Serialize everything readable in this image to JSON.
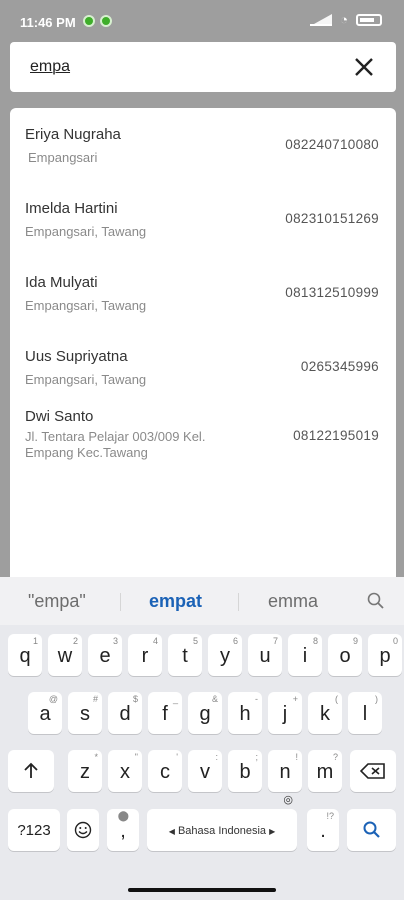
{
  "status_bar": {
    "time": "11:46 PM"
  },
  "search": {
    "query": "empa",
    "close_icon": "close-icon"
  },
  "results": [
    {
      "name": "Eriya Nugraha",
      "address": "Empangsari",
      "phone": "082240710080"
    },
    {
      "name": "Imelda Hartini",
      "address": "Empangsari, Tawang",
      "phone": "082310151269"
    },
    {
      "name": "Ida Mulyati",
      "address": "Empangsari, Tawang",
      "phone": "081312510999"
    },
    {
      "name": "Uus Supriyatna",
      "address": "Empangsari, Tawang",
      "phone": "0265345996"
    },
    {
      "name": "Dwi Santo",
      "address_line1": "Jl. Tentara Pelajar 003/009 Kel.",
      "address_line2": "Empang Kec.Tawang",
      "phone": "08122195019"
    }
  ],
  "keyboard": {
    "suggestions": [
      "\"empa\"",
      "empat",
      "emma"
    ],
    "row1": [
      {
        "k": "q",
        "h": "1"
      },
      {
        "k": "w",
        "h": "2"
      },
      {
        "k": "e",
        "h": "3"
      },
      {
        "k": "r",
        "h": "4"
      },
      {
        "k": "t",
        "h": "5"
      },
      {
        "k": "y",
        "h": "6"
      },
      {
        "k": "u",
        "h": "7"
      },
      {
        "k": "i",
        "h": "8"
      },
      {
        "k": "o",
        "h": "9"
      },
      {
        "k": "p",
        "h": "0"
      }
    ],
    "row2": [
      {
        "k": "a",
        "h": "@"
      },
      {
        "k": "s",
        "h": "#"
      },
      {
        "k": "d",
        "h": "$"
      },
      {
        "k": "f",
        "h": "_"
      },
      {
        "k": "g",
        "h": "&"
      },
      {
        "k": "h",
        "h": "-"
      },
      {
        "k": "j",
        "h": "+"
      },
      {
        "k": "k",
        "h": "("
      },
      {
        "k": "l",
        "h": ")"
      }
    ],
    "row3": [
      {
        "k": "z",
        "h": "*"
      },
      {
        "k": "x",
        "h": "\""
      },
      {
        "k": "c",
        "h": "'"
      },
      {
        "k": "v",
        "h": ":"
      },
      {
        "k": "b",
        "h": ";"
      },
      {
        "k": "n",
        "h": "!"
      },
      {
        "k": "m",
        "h": "?"
      }
    ],
    "shift_icon": "shift-arrow-icon",
    "backspace_icon": "backspace-icon",
    "symbols_label": "?123",
    "emoji_icon": "emoji-icon",
    "comma_label": ",",
    "space_label": "Bahasa Indonesia",
    "period_label": ".",
    "period_hint": "!?",
    "search_icon": "search-icon"
  }
}
